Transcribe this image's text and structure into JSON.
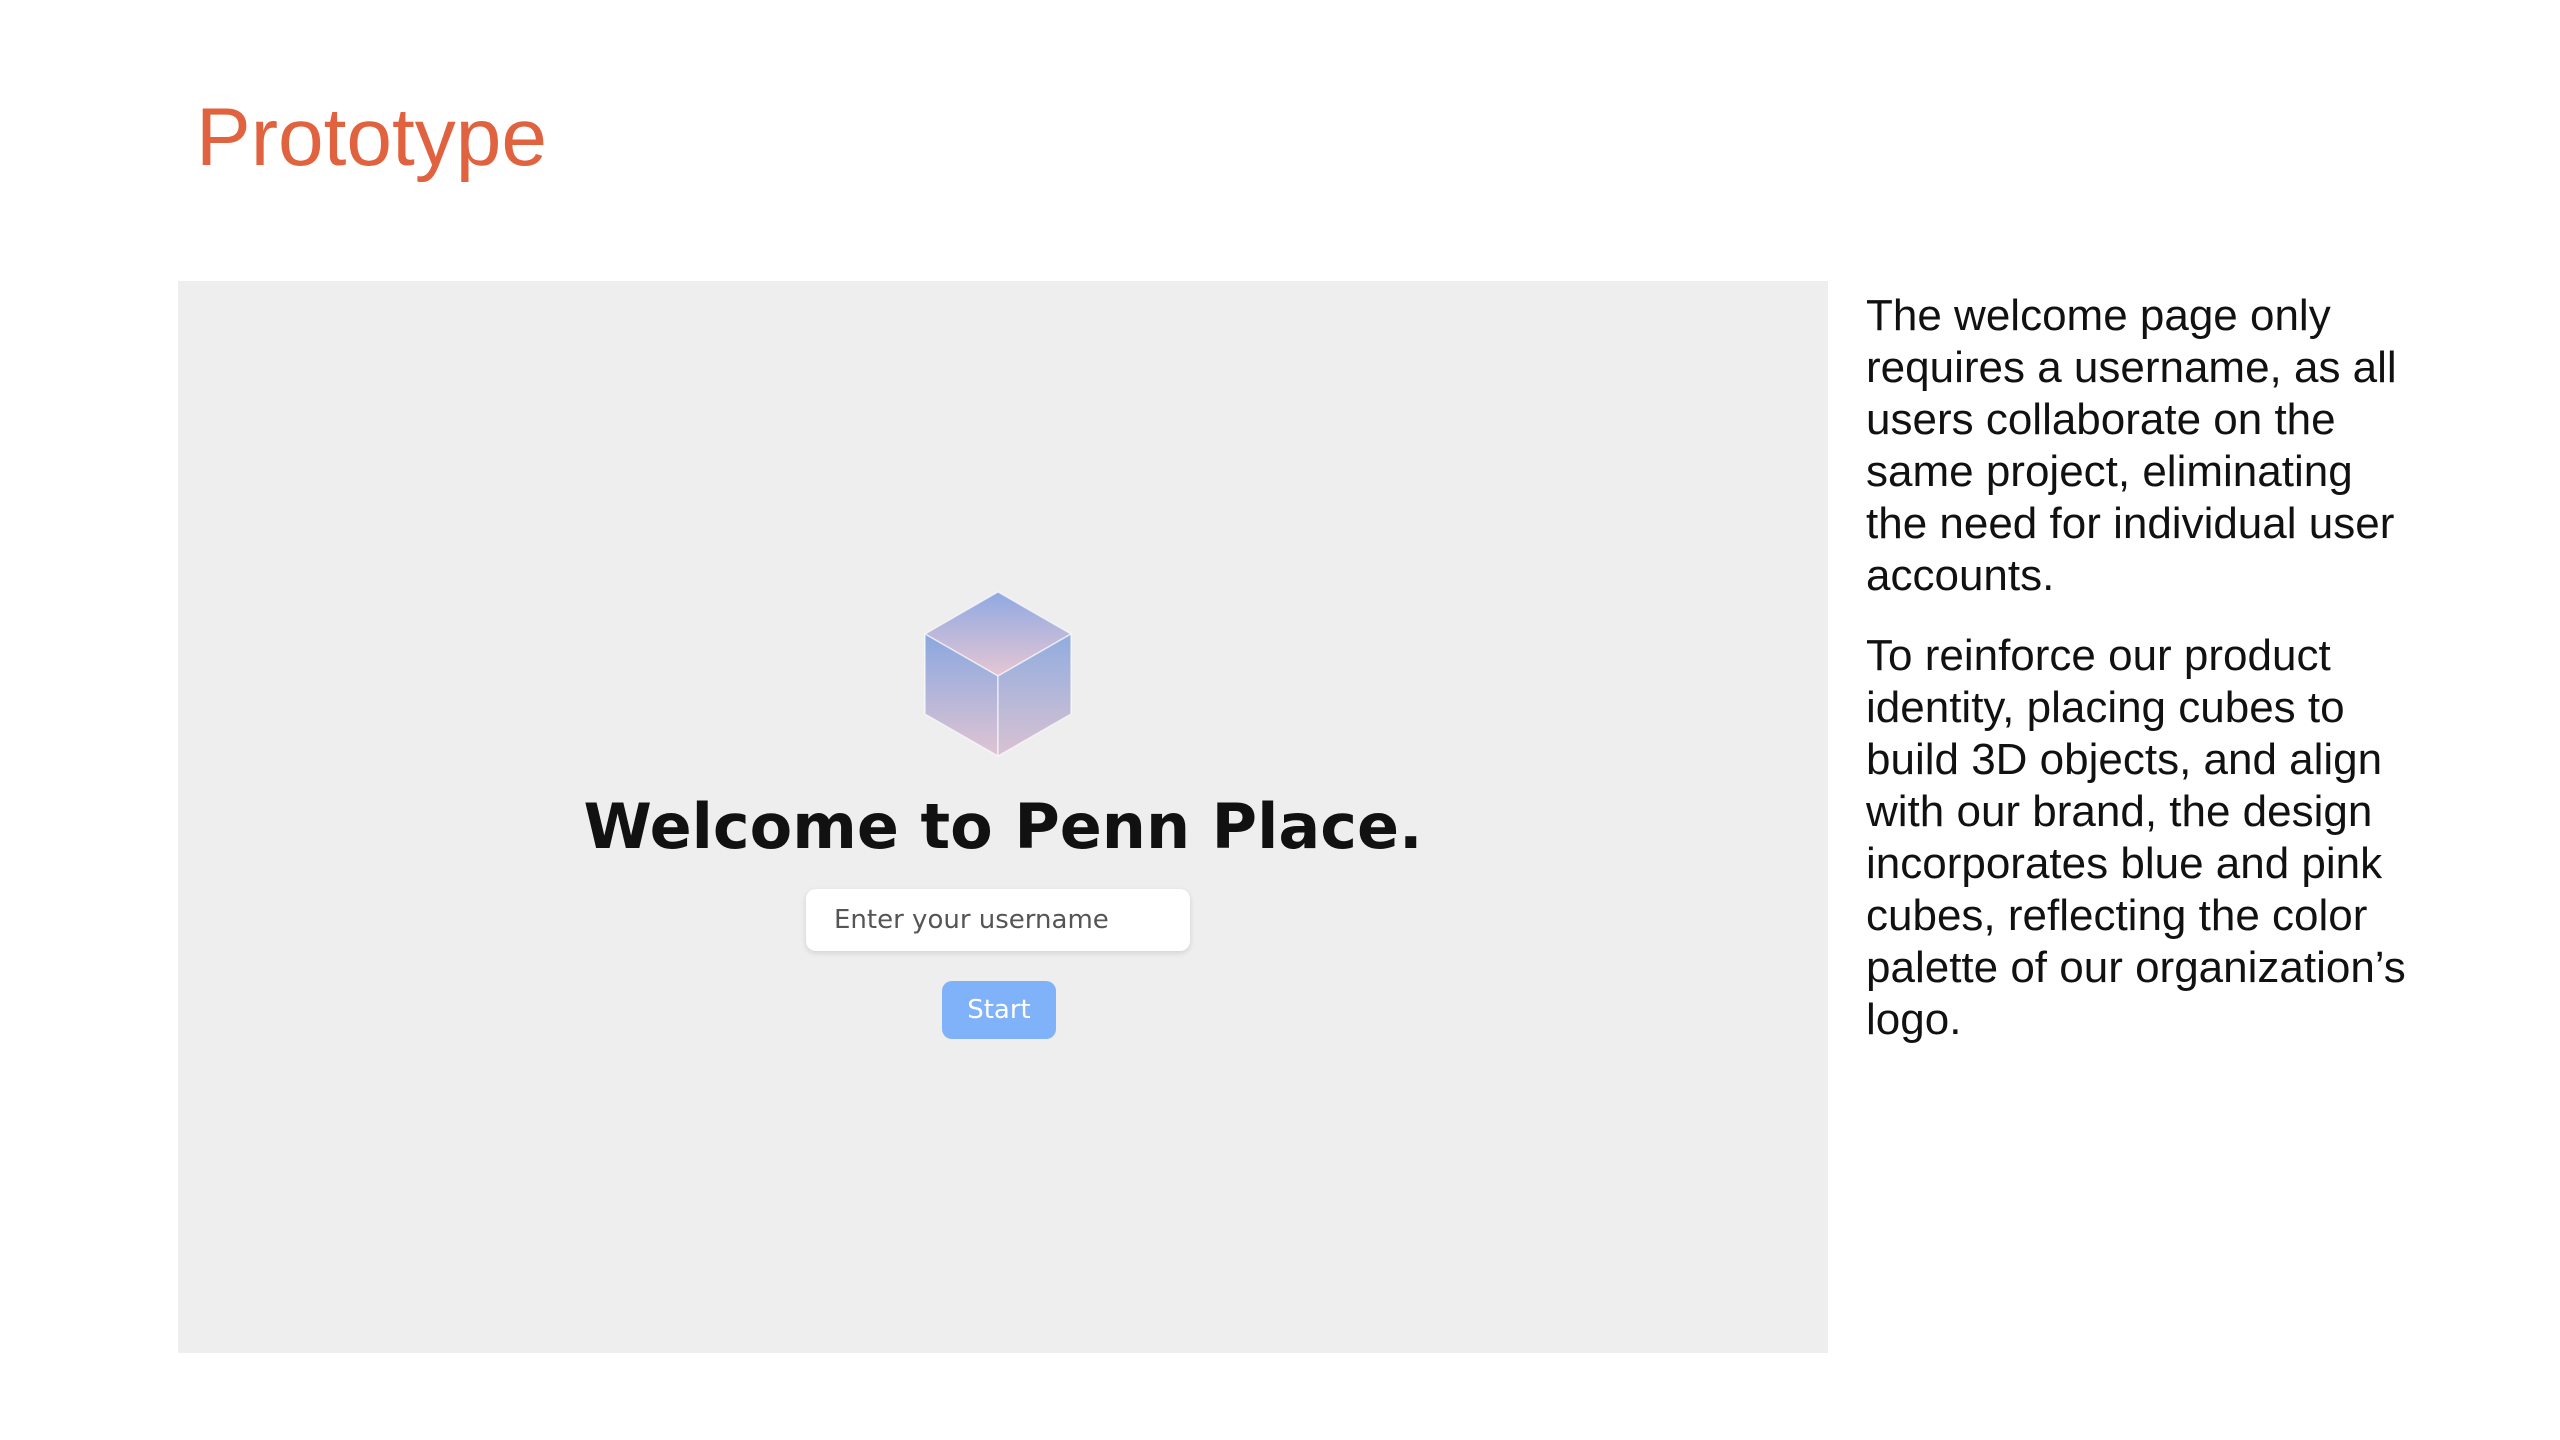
{
  "slide": {
    "title": "Prototype",
    "title_color": "#e0623f"
  },
  "prototype": {
    "background": "#eeeeee",
    "logo_icon": "gradient-cube-icon",
    "logo_colors": [
      "#8aa7e0",
      "#e2c3d2"
    ],
    "heading": "Welcome to Penn Place.",
    "username_input": {
      "placeholder": "Enter your username",
      "value": ""
    },
    "start_button": {
      "label": "Start",
      "color": "#7fb2f8"
    }
  },
  "notes": {
    "paragraph_1": "The welcome page only requires a username, as all users collaborate on the same project, eliminating the need for individual user accounts.",
    "paragraph_2": "To reinforce our product identity, placing cubes to build 3D objects, and align with our brand, the design incorporates blue and pink cubes, reflecting the color palette of our organization’s logo."
  }
}
